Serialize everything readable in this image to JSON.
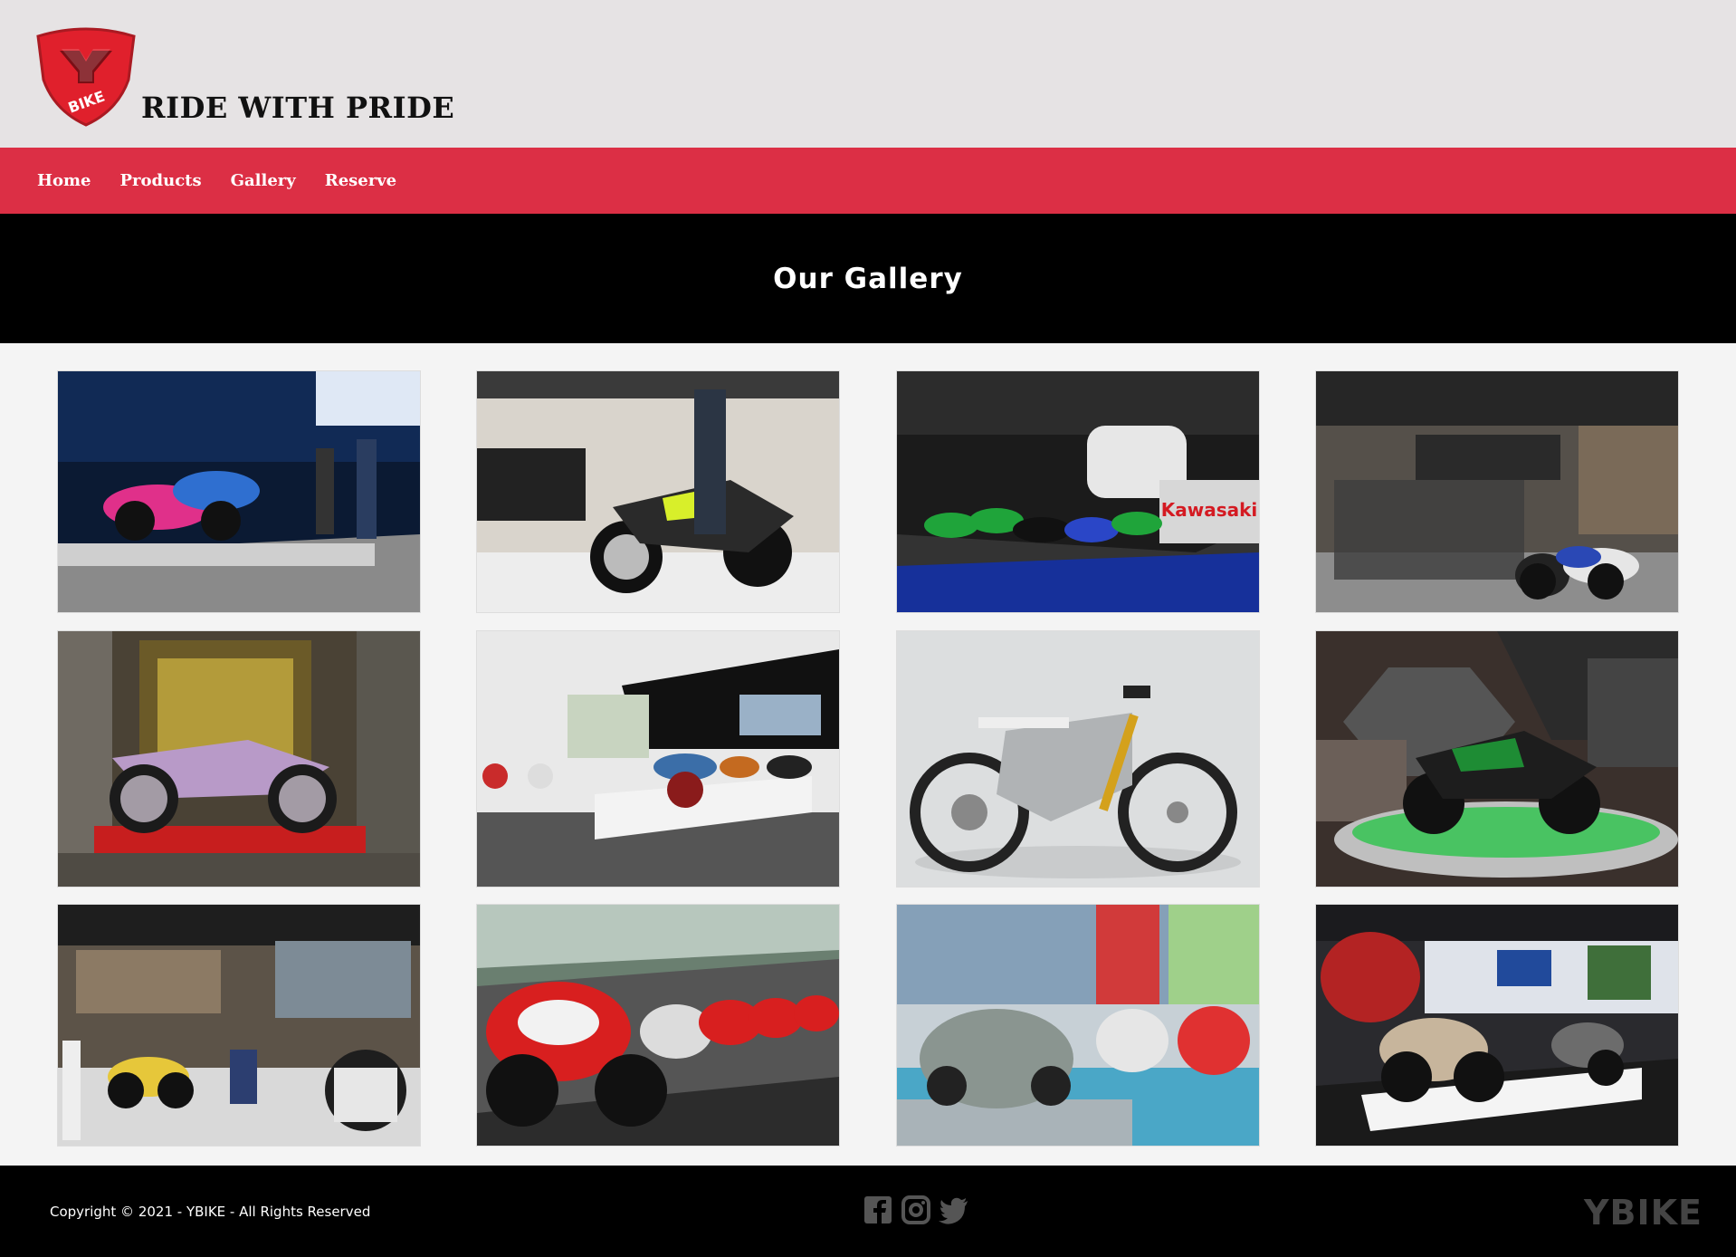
{
  "header": {
    "logo_text": "BIKE",
    "tagline": "RIDE WITH PRIDE"
  },
  "nav": {
    "items": [
      "Home",
      "Products",
      "Gallery",
      "Reserve"
    ]
  },
  "banner": {
    "title": "Our Gallery"
  },
  "gallery": {
    "images": [
      {
        "name": "motorcycle-exhibit-photo"
      },
      {
        "name": "adventure-bike-photo"
      },
      {
        "name": "kawasaki-stand-photo"
      },
      {
        "name": "expo-crowd-photo"
      },
      {
        "name": "cafe-racer-photo"
      },
      {
        "name": "museum-hall-photo"
      },
      {
        "name": "electric-dirtbike-photo"
      },
      {
        "name": "kawasaki-h2-photo"
      },
      {
        "name": "bmw-stand-photo"
      },
      {
        "name": "ducati-racers-photo"
      },
      {
        "name": "vespa-scooters-photo"
      },
      {
        "name": "mv-agusta-stand-photo"
      }
    ]
  },
  "footer": {
    "copyright": "Copyright © 2021 - YBIKE - All Rights Reserved",
    "brand": "YBIKE",
    "social_icons": [
      "facebook-icon",
      "instagram-icon",
      "twitter-icon"
    ]
  }
}
